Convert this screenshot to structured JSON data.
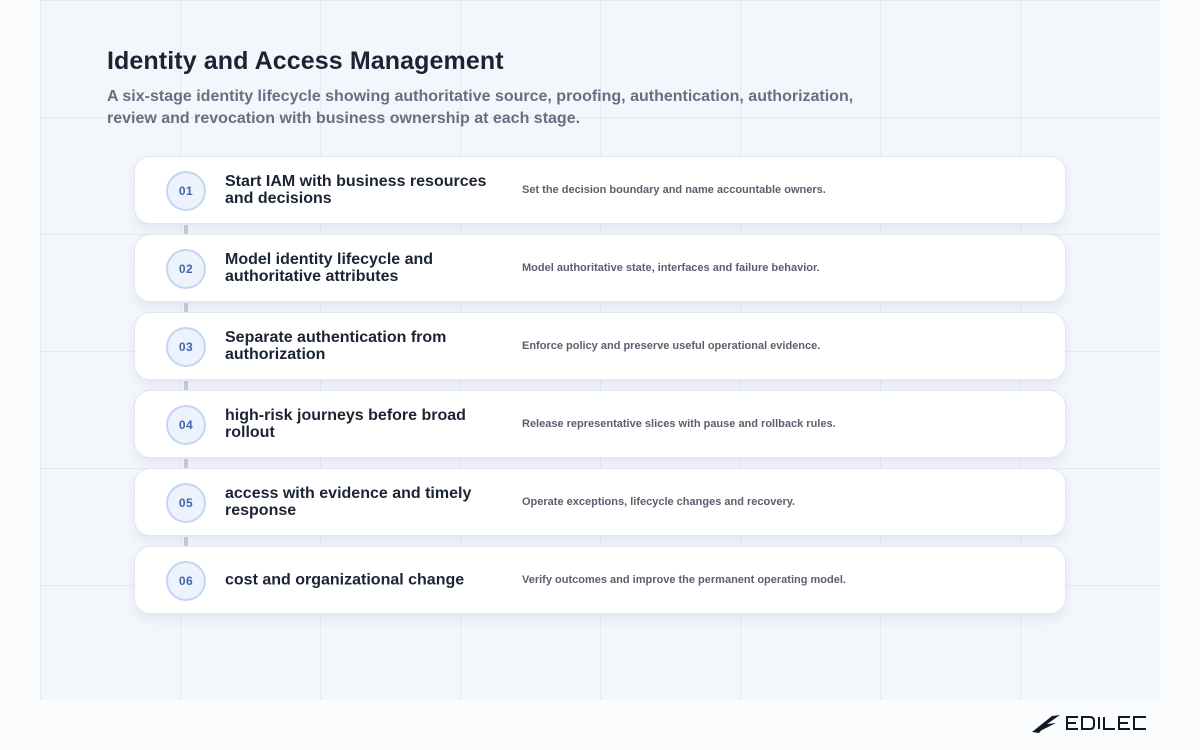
{
  "header": {
    "title": "Identity and Access Management",
    "subtitle": "A six-stage identity lifecycle showing authoritative source, proofing, authentication, authorization, review and revocation with business ownership at each stage."
  },
  "stages": [
    {
      "number": "01",
      "title": "Start IAM with business resources and decisions",
      "description": "Set the decision boundary and name accountable owners."
    },
    {
      "number": "02",
      "title": "Model identity lifecycle and authoritative attributes",
      "description": "Model authoritative state, interfaces and failure behavior."
    },
    {
      "number": "03",
      "title": "Separate authentication from authorization",
      "description": "Enforce policy and preserve useful operational evidence."
    },
    {
      "number": "04",
      "title": "high-risk journeys before broad rollout",
      "description": "Release representative slices with pause and rollback rules."
    },
    {
      "number": "05",
      "title": "access with evidence and timely response",
      "description": "Operate exceptions, lifecycle changes and recovery."
    },
    {
      "number": "06",
      "title": "cost and organizational change",
      "description": "Verify outcomes and improve the permanent operating model."
    }
  ],
  "footer": {
    "logo_text": "EDILEC"
  },
  "colors": {
    "background": "#f3f6fb",
    "card": "#ffffff",
    "badge_fill": "#edf3fc",
    "badge_border": "#c3d5f1",
    "badge_text": "#3f68ab",
    "title_text": "#1b2433",
    "muted_text": "#667082",
    "connector": "#c9ccd3"
  }
}
